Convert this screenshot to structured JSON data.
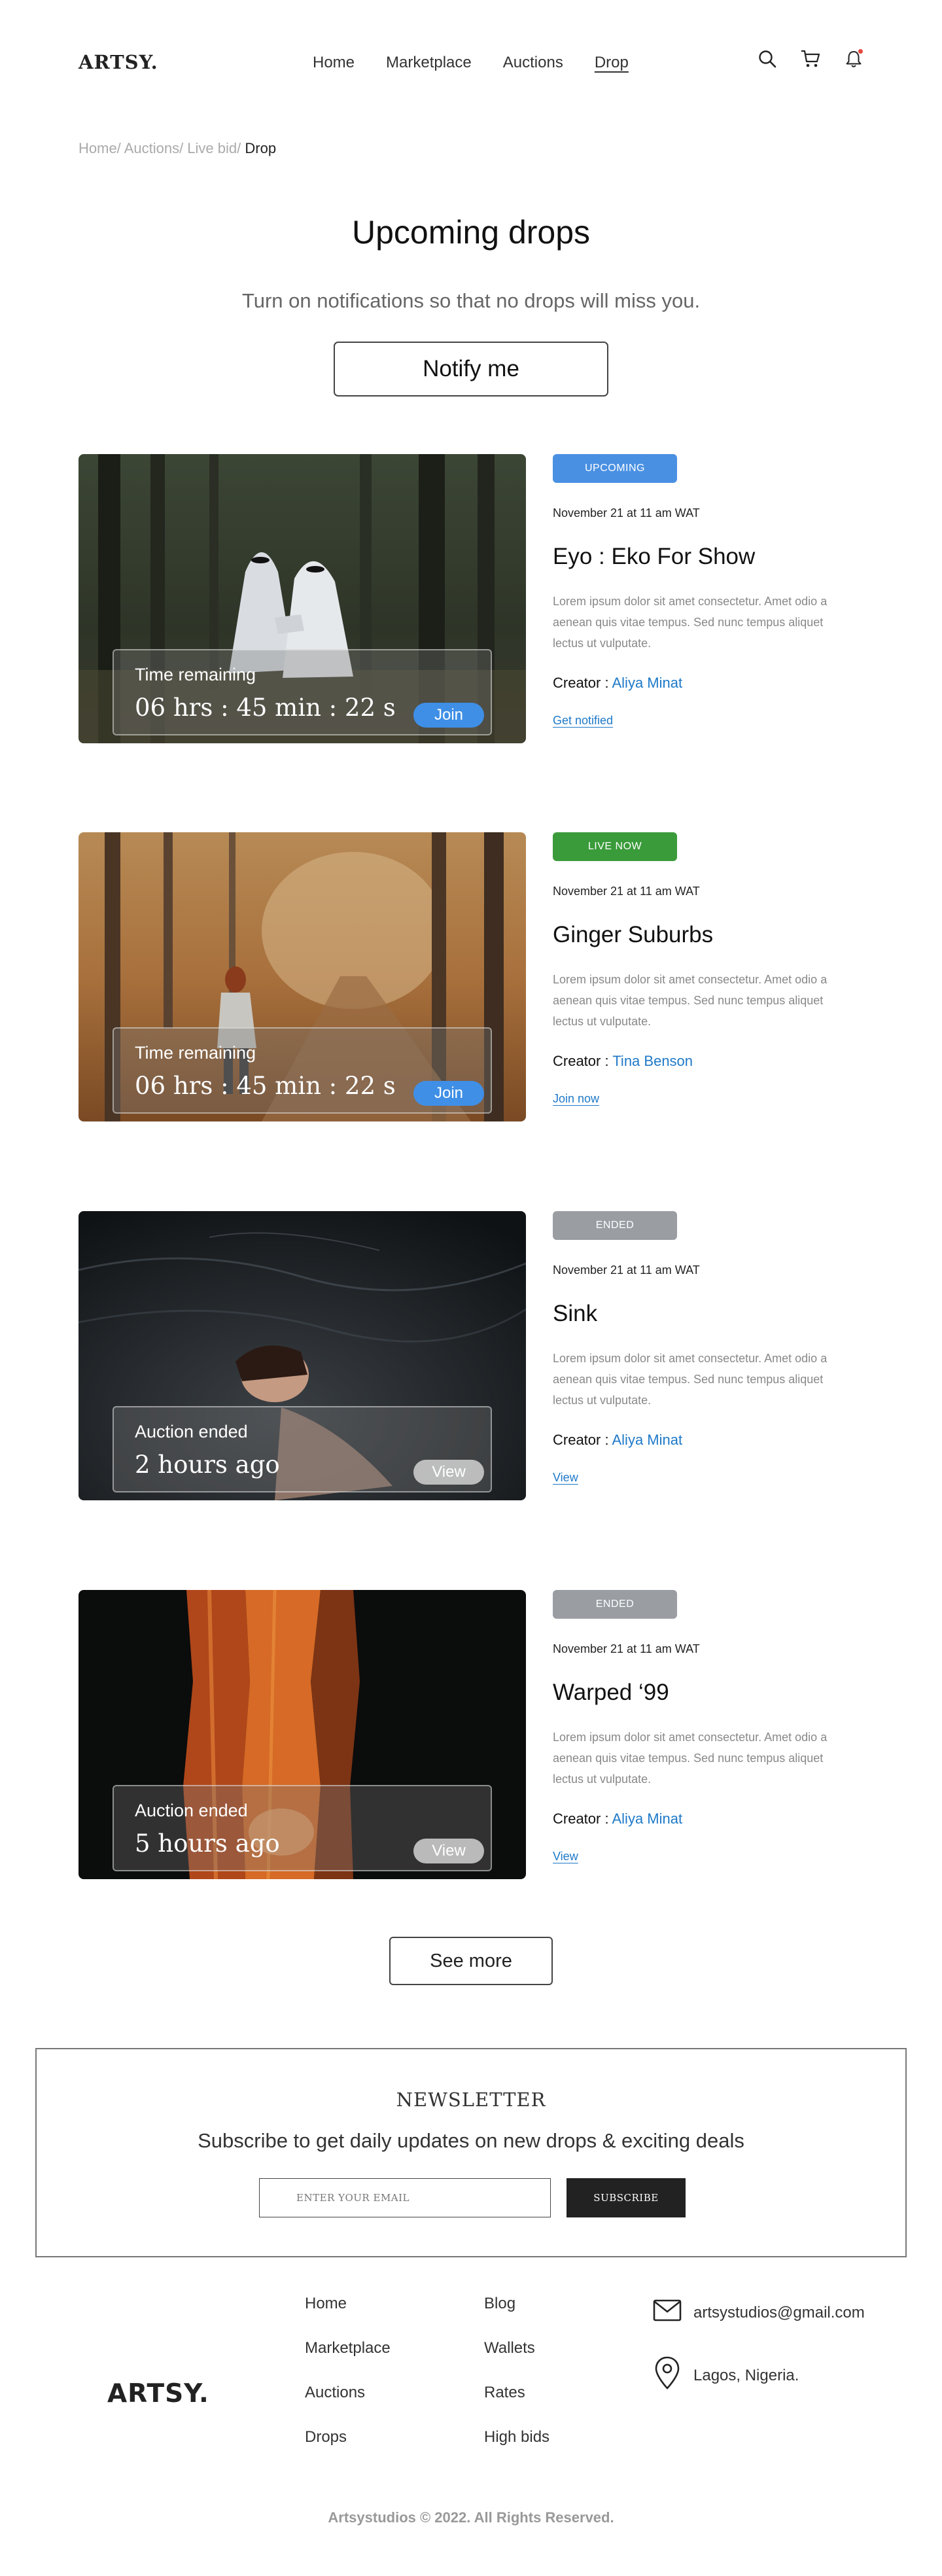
{
  "header": {
    "logo": "ARTSY.",
    "nav": [
      "Home",
      "Marketplace",
      "Auctions",
      "Drop"
    ],
    "active_nav": "Drop",
    "icons": [
      "search-icon",
      "cart-icon",
      "bell-icon"
    ]
  },
  "breadcrumb": {
    "trail": "Home/ Auctions/ Live bid/",
    "current": "Drop"
  },
  "hero": {
    "title": "Upcoming drops",
    "subtitle": "Turn on notifications so that no drops will miss you.",
    "notify_button": "Notify me"
  },
  "drops": [
    {
      "status": "UPCOMING",
      "status_color": "#4a90e2",
      "date": "November 21 at 11 am WAT",
      "title": "Eyo : Eko For Show",
      "description": "Lorem ipsum dolor sit amet consectetur. Amet odio a aenean quis vitae tempus. Sed nunc tempus aliquet lectus ut vulputate.",
      "creator_label": "Creator :",
      "creator": "Aliya Minat",
      "link": "Get notified",
      "overlay_label": "Time remaining",
      "overlay_value": "06  hrs : 45 min : 22 s",
      "overlay_button": "Join",
      "image": "forest-ghosts-photo"
    },
    {
      "status": "LIVE NOW",
      "status_color": "#3a9b3a",
      "date": "November 21 at 11 am WAT",
      "title": "Ginger Suburbs",
      "description": "Lorem ipsum dolor sit amet consectetur. Amet odio a aenean quis vitae tempus. Sed nunc tempus aliquet lectus ut vulputate.",
      "creator_label": "Creator :",
      "creator": "Tina Benson",
      "link": "Join now",
      "overlay_label": "Time remaining",
      "overlay_value": "06  hrs : 45 min : 22 s",
      "overlay_button": "Join",
      "image": "autumn-forest-path-photo"
    },
    {
      "status": "ENDED",
      "status_color": "#9a9ea3",
      "date": "November 21 at 11 am WAT",
      "title": "Sink",
      "description": "Lorem ipsum dolor sit amet consectetur. Amet odio a aenean quis vitae tempus. Sed nunc tempus aliquet lectus ut vulputate.",
      "creator_label": "Creator :",
      "creator": "Aliya Minat",
      "link": "View",
      "overlay_label": "Auction ended",
      "overlay_value": "2 hours ago",
      "overlay_button": "View",
      "image": "woman-in-dark-water-photo"
    },
    {
      "status": "ENDED",
      "status_color": "#9a9ea3",
      "date": "November 21 at 11 am WAT",
      "title": "Warped ‘99",
      "description": "Lorem ipsum dolor sit amet consectetur. Amet odio a aenean quis vitae tempus. Sed nunc tempus aliquet lectus ut vulputate.",
      "creator_label": "Creator :",
      "creator": "Aliya Minat",
      "link": "View",
      "overlay_label": "Auction ended",
      "overlay_value": "5 hours ago",
      "overlay_button": "View",
      "image": "orange-fabric-dark-photo"
    }
  ],
  "see_more": "See more",
  "newsletter": {
    "title": "NEWSLETTER",
    "subtitle": "Subscribe to get daily updates on new drops & exciting deals",
    "email_placeholder": "ENTER YOUR EMAIL",
    "subscribe_button": "SUBSCRIBE"
  },
  "footer": {
    "logo": "ARTSY.",
    "col1": [
      "Home",
      "Marketplace",
      "Auctions",
      "Drops"
    ],
    "col2": [
      "Blog",
      "Wallets",
      "Rates",
      "High bids"
    ],
    "email": "artsystudios@gmail.com",
    "location": "Lagos, Nigeria.",
    "copyright": "Artsystudios © 2022. All Rights Reserved."
  }
}
